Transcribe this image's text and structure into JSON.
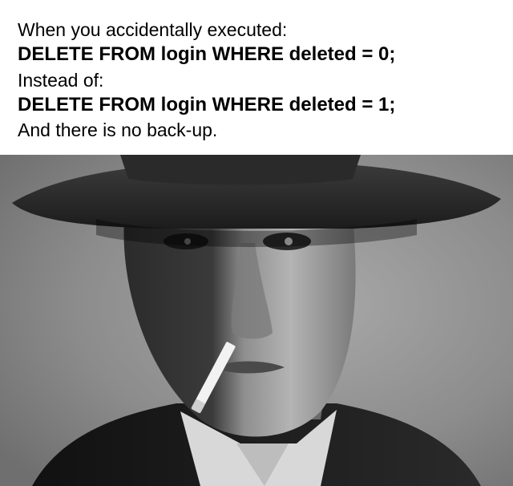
{
  "caption": {
    "line1": "When you accidentally executed:",
    "line2": "DELETE FROM login WHERE deleted = 0;",
    "line3": "Instead of:",
    "line4": "DELETE FROM login WHERE deleted = 1;",
    "line5": "And there is no back-up."
  },
  "photo": {
    "style": "black-and-white",
    "subject": "man-in-fedora-with-cigarette"
  }
}
